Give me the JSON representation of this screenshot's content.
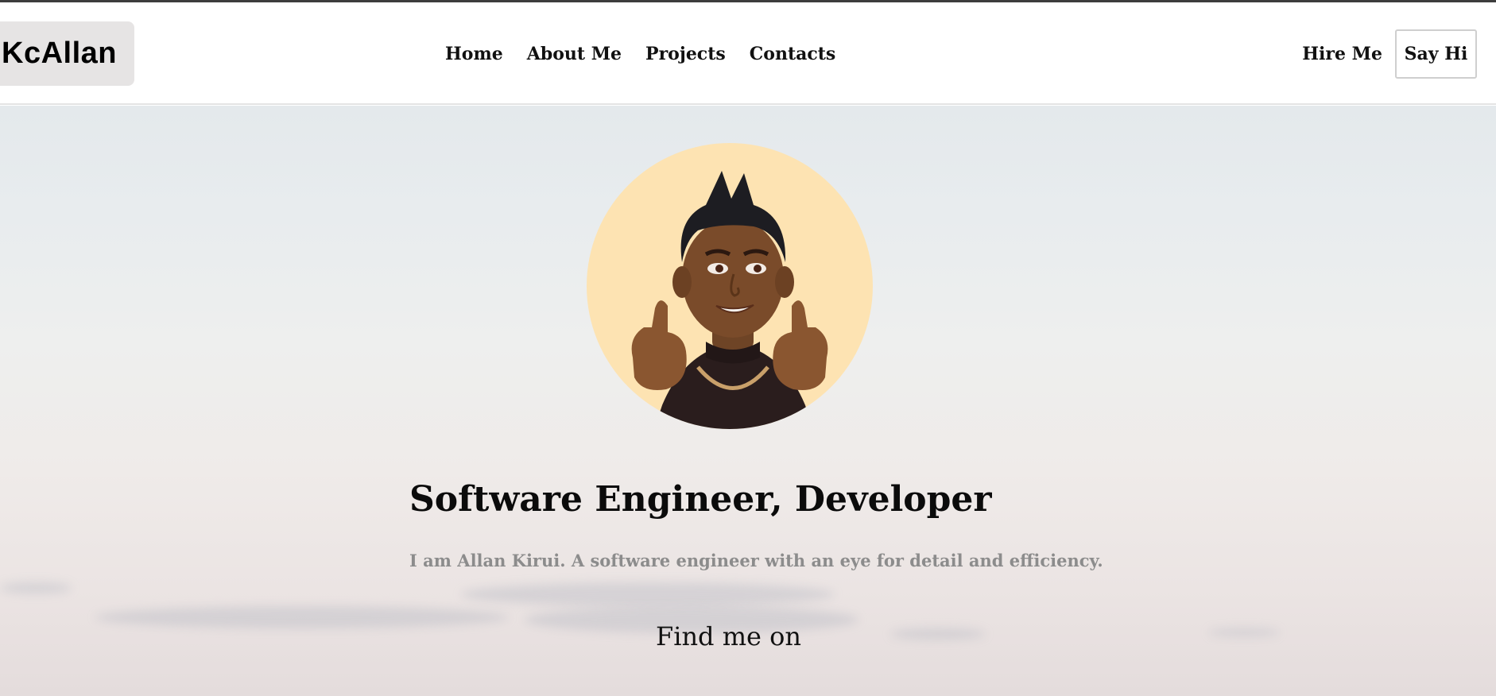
{
  "header": {
    "logo": "KcAllan",
    "nav": [
      {
        "label": "Home"
      },
      {
        "label": "About Me"
      },
      {
        "label": "Projects"
      },
      {
        "label": "Contacts"
      }
    ],
    "hire_label": "Hire Me",
    "say_hi_label": "Say Hi"
  },
  "hero": {
    "headline": "Software Engineer, Developer",
    "subline": "I am Allan Kirui. A software engineer with an eye for detail and efficiency.",
    "find_me": "Find me on"
  },
  "colors": {
    "avatar_bg": "#fde3b2",
    "subline": "#8c8c8c",
    "logo_bg": "#e6e4e4"
  }
}
